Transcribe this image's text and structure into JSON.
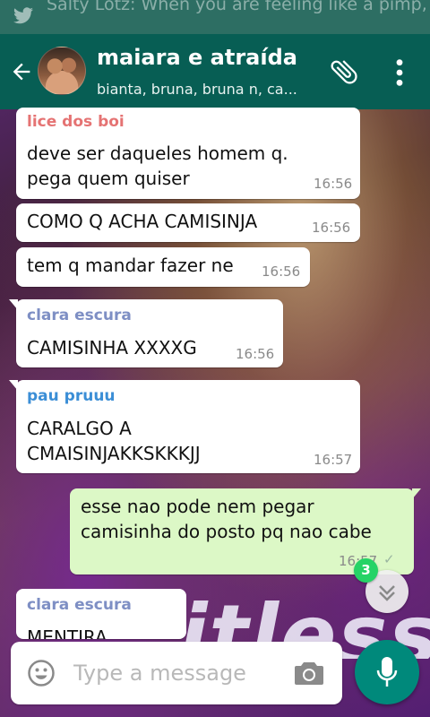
{
  "notification": {
    "text": "Salty Lotz: When you are feeling like a pimp, go ahead and brush your shoulders off",
    "icon": "twitter-icon"
  },
  "header": {
    "title": "maiara e atraída",
    "subtitle": "bianta, bruna, bruna n, ca...",
    "back_icon": "back-arrow-icon",
    "attach_icon": "paperclip-icon",
    "menu_icon": "more-vert-icon"
  },
  "messages": [
    {
      "sender": "lice dos boi",
      "sender_color": "#e57373",
      "text": "deve ser daqueles homem q.\npega quem quiser",
      "time": "16:56",
      "direction": "in"
    },
    {
      "text": "COMO Q ACHA CAMISINJA",
      "time": "16:56",
      "direction": "in"
    },
    {
      "text": "tem q mandar fazer ne",
      "time": "16:56",
      "direction": "in"
    },
    {
      "sender": "clara escura",
      "sender_color": "#7e8fc4",
      "text": "CAMISINHA XXXXG",
      "time": "16:56",
      "direction": "in"
    },
    {
      "sender": "pau pruuu",
      "sender_color": "#3b8ed6",
      "text": "CARALGO A\nCMAISINJAKKSKKKJJ",
      "time": "16:57",
      "direction": "in"
    },
    {
      "text": "esse nao pode nem pegar\ncamisinha do posto pq nao cabe",
      "time": "16:57",
      "direction": "out",
      "status": "✓"
    },
    {
      "sender": "clara escura",
      "sender_color": "#7e8fc4",
      "text": "MENTIRA",
      "direction": "in"
    }
  ],
  "wallpaper_text": "itless",
  "scroll": {
    "unread_count": "3",
    "icon": "double-chevron-down-icon"
  },
  "composer": {
    "placeholder": "Type a message",
    "emoji_icon": "emoji-icon",
    "camera_icon": "camera-icon",
    "mic_icon": "mic-icon"
  },
  "colors": {
    "header": "#075e54",
    "accent": "#00897b",
    "badge": "#25d366",
    "outgoing_bubble": "#dcf8c6",
    "incoming_bubble": "#ffffff"
  }
}
